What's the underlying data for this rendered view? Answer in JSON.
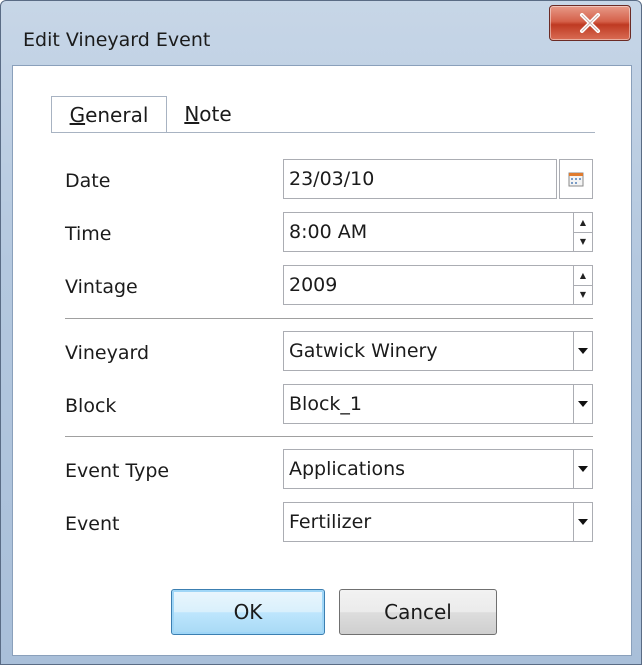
{
  "window": {
    "title": "Edit Vineyard Event"
  },
  "tabs": [
    {
      "label": "General",
      "accel": "G",
      "rest": "eneral"
    },
    {
      "label": "Note",
      "accel": "N",
      "rest": "ote"
    }
  ],
  "fields": {
    "date": {
      "label": "Date",
      "value": "23/03/10"
    },
    "time": {
      "label": "Time",
      "value": "8:00 AM"
    },
    "vintage": {
      "label": "Vintage",
      "value": "2009"
    },
    "vineyard": {
      "label": "Vineyard",
      "value": "Gatwick Winery"
    },
    "block": {
      "label": "Block",
      "value": "Block_1"
    },
    "event_type": {
      "label": "Event Type",
      "value": "Applications"
    },
    "event": {
      "label": "Event",
      "value": "Fertilizer"
    }
  },
  "buttons": {
    "ok": "OK",
    "cancel": "Cancel"
  },
  "icons": {
    "close": "close-icon",
    "calendar": "calendar-icon",
    "spin_up": "spin-up-icon",
    "spin_down": "spin-down-icon",
    "dropdown": "dropdown-arrow-icon"
  },
  "colors": {
    "close_red": "#c9432b",
    "ok_highlight": "#3c7fb1"
  }
}
